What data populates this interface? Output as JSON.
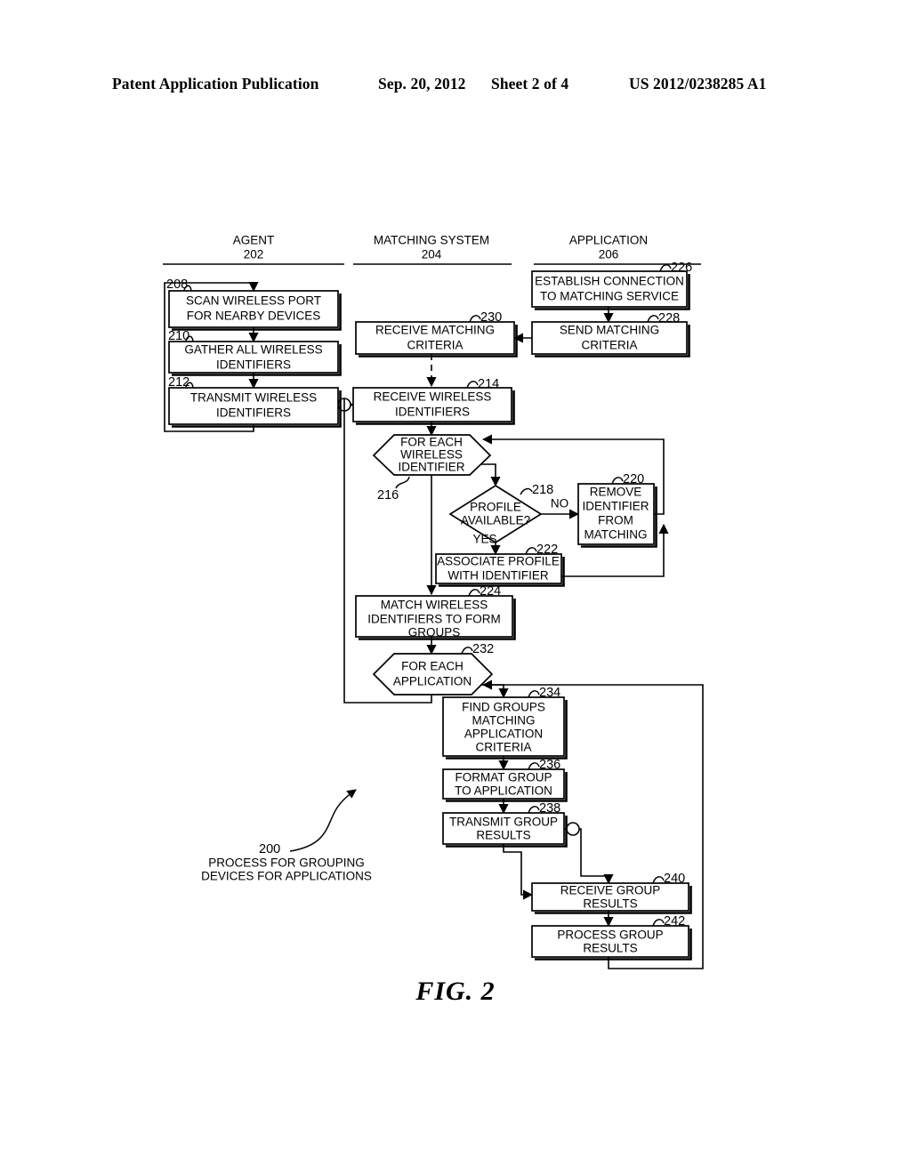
{
  "header": {
    "publication": "Patent Application Publication",
    "date": "Sep. 20, 2012",
    "sheet": "Sheet 2 of 4",
    "number": "US 2012/0238285 A1"
  },
  "figure": {
    "caption": "FIG. 2",
    "process_ref": "200",
    "process_title_line1": "PROCESS FOR GROUPING",
    "process_title_line2": "DEVICES FOR APPLICATIONS"
  },
  "lanes": [
    {
      "title": "AGENT",
      "ref": "202"
    },
    {
      "title": "MATCHING SYSTEM",
      "ref": "204"
    },
    {
      "title": "APPLICATION",
      "ref": "206"
    }
  ],
  "nodes": {
    "n208": {
      "ref": "208",
      "lines": [
        "SCAN WIRELESS PORT",
        "FOR NEARBY DEVICES"
      ],
      "shape": "process",
      "lane": "AGENT"
    },
    "n210": {
      "ref": "210",
      "lines": [
        "GATHER ALL WIRELESS",
        "IDENTIFIERS"
      ],
      "shape": "process",
      "lane": "AGENT"
    },
    "n212": {
      "ref": "212",
      "lines": [
        "TRANSMIT WIRELESS",
        "IDENTIFIERS"
      ],
      "shape": "process",
      "lane": "AGENT"
    },
    "n230": {
      "ref": "230",
      "lines": [
        "RECEIVE MATCHING",
        "CRITERIA"
      ],
      "shape": "process",
      "lane": "MATCHING SYSTEM"
    },
    "n214": {
      "ref": "214",
      "lines": [
        "RECEIVE WIRELESS",
        "IDENTIFIERS"
      ],
      "shape": "process",
      "lane": "MATCHING SYSTEM"
    },
    "n216": {
      "ref": "216",
      "lines": [
        "FOR EACH",
        "WIRELESS",
        "IDENTIFIER"
      ],
      "shape": "loop",
      "lane": "MATCHING SYSTEM"
    },
    "n218": {
      "ref": "218",
      "lines": [
        "PROFILE",
        "AVAILABLE?"
      ],
      "shape": "decision",
      "lane": "MATCHING SYSTEM"
    },
    "n220": {
      "ref": "220",
      "lines": [
        "REMOVE",
        "IDENTIFIER",
        "FROM",
        "MATCHING"
      ],
      "shape": "process",
      "lane": "MATCHING SYSTEM"
    },
    "n222": {
      "ref": "222",
      "lines": [
        "ASSOCIATE PROFILE",
        "WITH IDENTIFIER"
      ],
      "shape": "process",
      "lane": "MATCHING SYSTEM"
    },
    "n224": {
      "ref": "224",
      "lines": [
        "MATCH WIRELESS",
        "IDENTIFIERS TO FORM",
        "GROUPS"
      ],
      "shape": "process",
      "lane": "MATCHING SYSTEM"
    },
    "n232": {
      "ref": "232",
      "lines": [
        "FOR EACH",
        "APPLICATION"
      ],
      "shape": "loop",
      "lane": "MATCHING SYSTEM"
    },
    "n234": {
      "ref": "234",
      "lines": [
        "FIND GROUPS",
        "MATCHING",
        "APPLICATION",
        "CRITERIA"
      ],
      "shape": "process",
      "lane": "MATCHING SYSTEM"
    },
    "n236": {
      "ref": "236",
      "lines": [
        "FORMAT GROUP",
        "TO APPLICATION"
      ],
      "shape": "process",
      "lane": "MATCHING SYSTEM"
    },
    "n238": {
      "ref": "238",
      "lines": [
        "TRANSMIT GROUP",
        "RESULTS"
      ],
      "shape": "process",
      "lane": "MATCHING SYSTEM"
    },
    "n226": {
      "ref": "226",
      "lines": [
        "ESTABLISH CONNECTION",
        "TO MATCHING SERVICE"
      ],
      "shape": "process",
      "lane": "APPLICATION"
    },
    "n228": {
      "ref": "228",
      "lines": [
        "SEND MATCHING",
        "CRITERIA"
      ],
      "shape": "process",
      "lane": "APPLICATION"
    },
    "n240": {
      "ref": "240",
      "lines": [
        "RECEIVE GROUP",
        "RESULTS"
      ],
      "shape": "process",
      "lane": "APPLICATION"
    },
    "n242": {
      "ref": "242",
      "lines": [
        "PROCESS GROUP",
        "RESULTS"
      ],
      "shape": "process",
      "lane": "APPLICATION"
    }
  },
  "branch_labels": {
    "no": "NO",
    "yes": "YES"
  }
}
